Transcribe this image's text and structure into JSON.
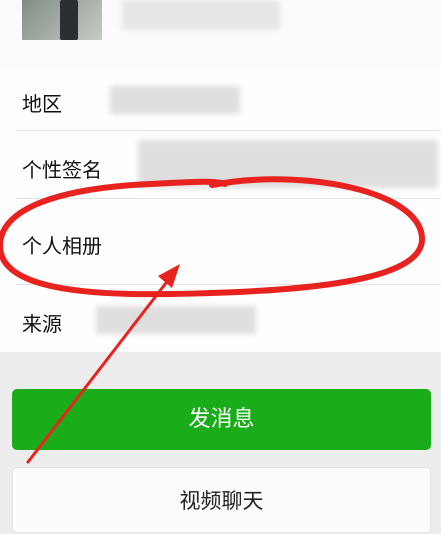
{
  "profile": {
    "rows": [
      {
        "label": "地区"
      },
      {
        "label": "个性签名"
      },
      {
        "label": "个人相册"
      },
      {
        "label": "来源"
      }
    ]
  },
  "actions": {
    "send_message": "发消息",
    "video_call": "视频聊天"
  },
  "colors": {
    "primary_button": "#1aad19",
    "annotation": "#e8231f",
    "background": "#ededed"
  }
}
